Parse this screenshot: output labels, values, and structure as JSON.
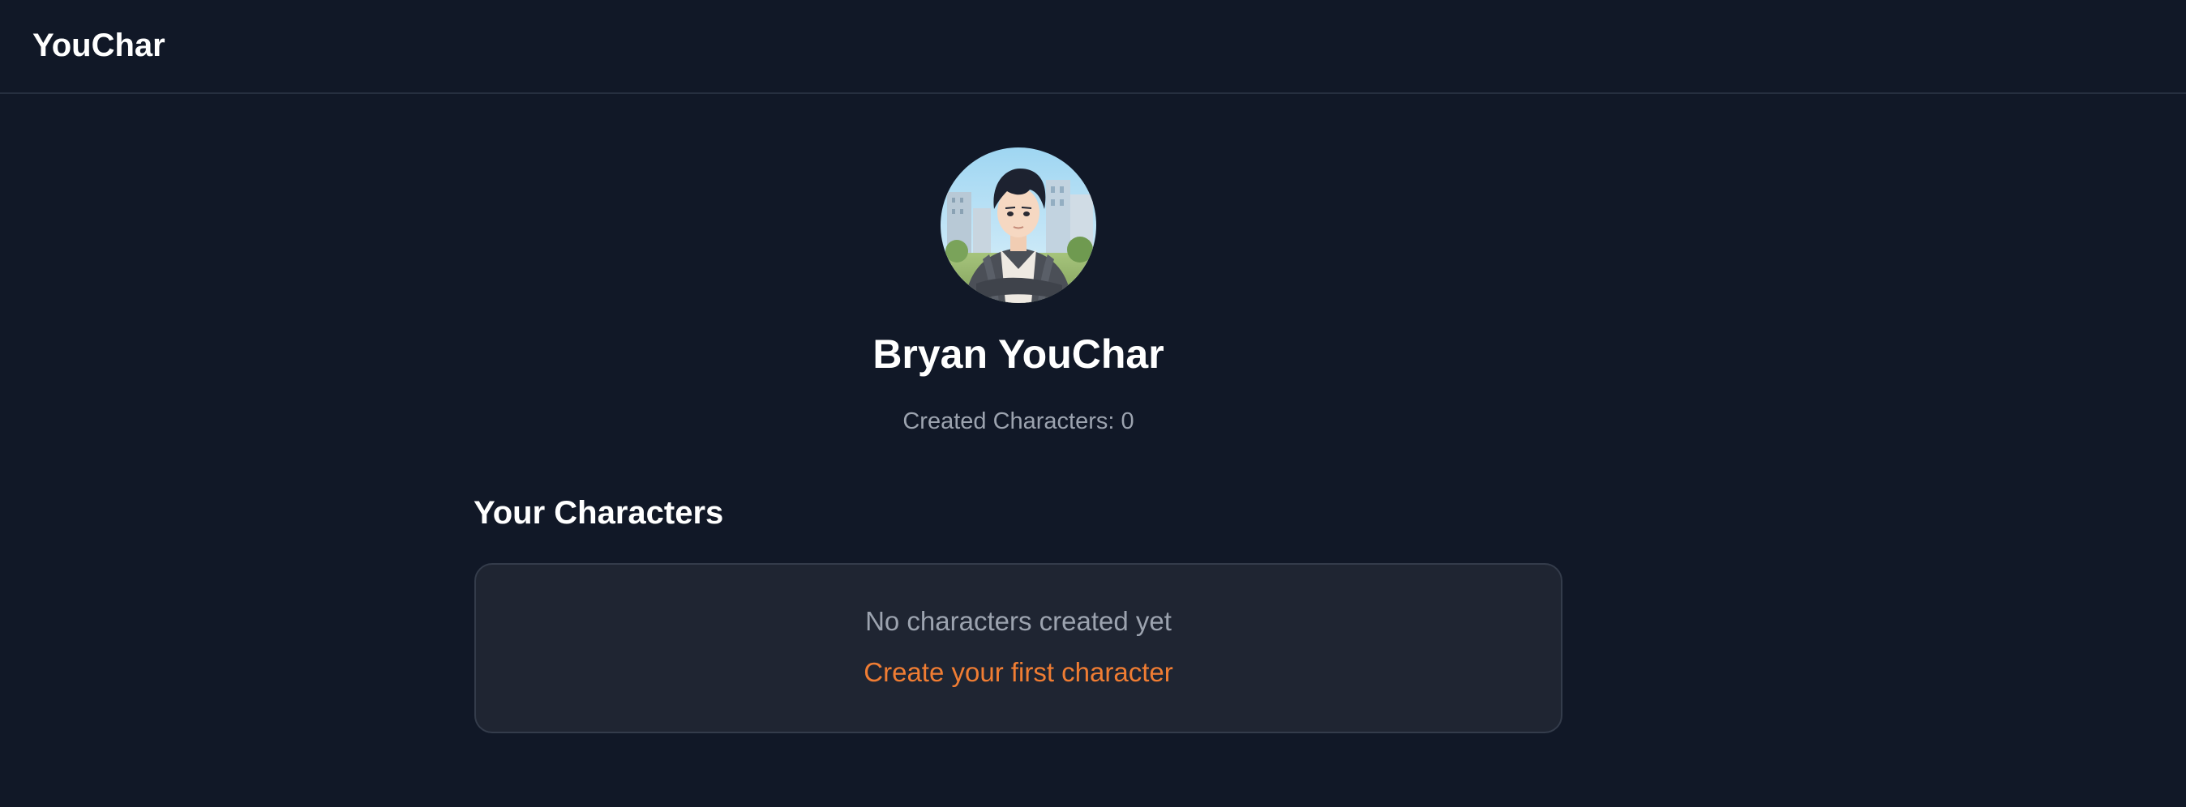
{
  "app": {
    "brand": "YouChar",
    "colors": {
      "background": "#111827",
      "card": "#1f2532",
      "accent": "#f07d33",
      "muted_text": "#9ca3af"
    }
  },
  "profile": {
    "avatar_icon": "user-portrait-illustration",
    "name": "Bryan YouChar",
    "stats": "Created Characters: 0"
  },
  "characters": {
    "section_title": "Your Characters",
    "empty_message": "No characters created yet",
    "create_link_label": "Create your first character"
  }
}
